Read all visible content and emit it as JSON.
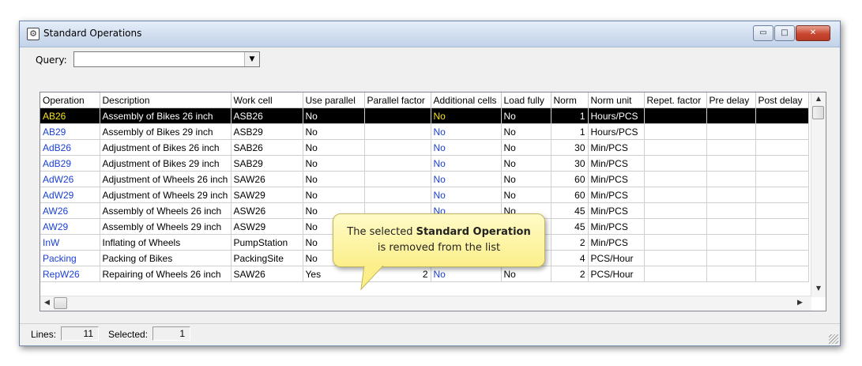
{
  "window": {
    "title": "Standard Operations",
    "app_icon": "gear-icon",
    "buttons": {
      "minimize": "▭",
      "maximize": "□",
      "close": "✕"
    }
  },
  "query": {
    "label": "Query:",
    "value": "",
    "arrow": "▼"
  },
  "grid": {
    "columns": [
      "Operation",
      "Description",
      "Work cell",
      "Use parallel",
      "Parallel factor",
      "Additional cells",
      "Load fully",
      "Norm",
      "Norm unit",
      "Repet. factor",
      "Pre delay",
      "Post delay"
    ],
    "rows": [
      [
        "AB26",
        "Assembly of Bikes 26 inch",
        "ASB26",
        "No",
        "",
        "No",
        "No",
        "1",
        "Hours/PCS",
        "",
        "",
        ""
      ],
      [
        "AB29",
        "Assembly of Bikes 29 inch",
        "ASB29",
        "No",
        "",
        "No",
        "No",
        "1",
        "Hours/PCS",
        "",
        "",
        ""
      ],
      [
        "AdB26",
        "Adjustment of Bikes 26 inch",
        "SAB26",
        "No",
        "",
        "No",
        "No",
        "30",
        "Min/PCS",
        "",
        "",
        ""
      ],
      [
        "AdB29",
        "Adjustment of Bikes 29 inch",
        "SAB29",
        "No",
        "",
        "No",
        "No",
        "30",
        "Min/PCS",
        "",
        "",
        ""
      ],
      [
        "AdW26",
        "Adjustment of Wheels 26 inch",
        "SAW26",
        "No",
        "",
        "No",
        "No",
        "60",
        "Min/PCS",
        "",
        "",
        ""
      ],
      [
        "AdW29",
        "Adjustment of Wheels 29 inch",
        "SAW29",
        "No",
        "",
        "No",
        "No",
        "60",
        "Min/PCS",
        "",
        "",
        ""
      ],
      [
        "AW26",
        "Assembly of Wheels 26 inch",
        "ASW26",
        "No",
        "",
        "No",
        "No",
        "45",
        "Min/PCS",
        "",
        "",
        ""
      ],
      [
        "AW29",
        "Assembly of Wheels 29 inch",
        "ASW29",
        "No",
        "",
        "",
        "",
        "45",
        "Min/PCS",
        "",
        "",
        ""
      ],
      [
        "InW",
        "Inflating of Wheels",
        "PumpStation",
        "No",
        "",
        "",
        "",
        "2",
        "Min/PCS",
        "",
        "",
        ""
      ],
      [
        "Packing",
        "Packing of Bikes",
        "PackingSite",
        "No",
        "",
        "",
        "",
        "4",
        "PCS/Hour",
        "",
        "",
        ""
      ],
      [
        "RepW26",
        "Repairing of Wheels 26 inch",
        "SAW26",
        "Yes",
        "2",
        "No",
        "No",
        "2",
        "PCS/Hour",
        "",
        "",
        ""
      ]
    ],
    "selected_index": 0
  },
  "scroll": {
    "up": "▲",
    "down": "▼",
    "left": "◀",
    "right": "▶"
  },
  "status": {
    "lines_label": "Lines:",
    "lines_value": "11",
    "selected_label": "Selected:",
    "selected_value": "1"
  },
  "callout": {
    "pre": "The selected ",
    "bold": "Standard Operation",
    "post": "is removed from the list"
  },
  "colors": {
    "selected_row_bg": "#000000",
    "selected_highlight": "#f7e316",
    "link_blue": "#1a3fd6",
    "callout_bg": "#fcef8a"
  }
}
